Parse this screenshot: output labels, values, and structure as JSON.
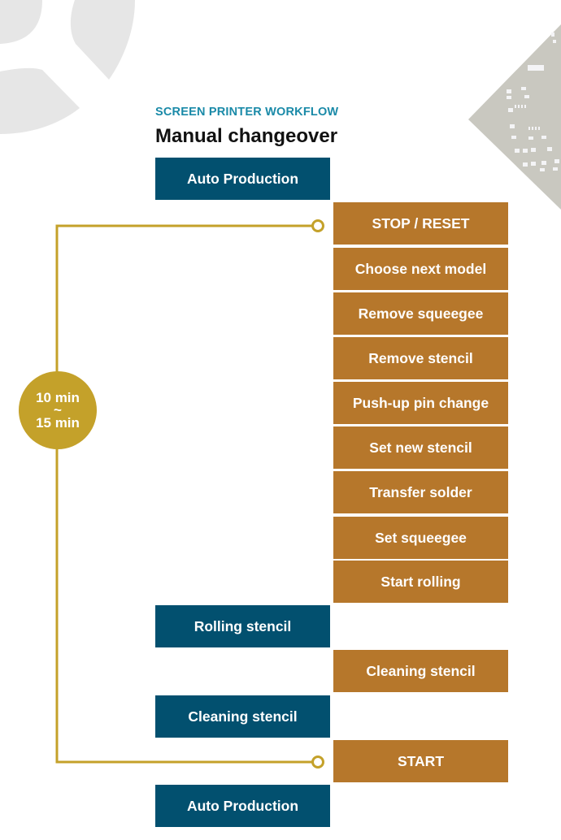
{
  "header": {
    "subtitle": "SCREEN PRINTER WORKFLOW",
    "title": "Manual changeover"
  },
  "colors": {
    "machine_step": "#02506f",
    "operator_step": "#b6772b",
    "timeline": "#c4a12a",
    "subtitle": "#1a8aa8"
  },
  "timer": {
    "from": "10 min",
    "separator": "~",
    "to": "15 min"
  },
  "steps": [
    {
      "label": "Auto Production",
      "lane": "machine"
    },
    {
      "label": "STOP / RESET",
      "lane": "operator"
    },
    {
      "label": "Choose next model",
      "lane": "operator"
    },
    {
      "label": "Remove squeegee",
      "lane": "operator"
    },
    {
      "label": "Remove stencil",
      "lane": "operator"
    },
    {
      "label": "Push-up pin change",
      "lane": "operator"
    },
    {
      "label": "Set new stencil",
      "lane": "operator"
    },
    {
      "label": "Transfer solder",
      "lane": "operator"
    },
    {
      "label": "Set squeegee",
      "lane": "operator"
    },
    {
      "label": "Start rolling",
      "lane": "operator"
    },
    {
      "label": "Rolling stencil",
      "lane": "machine"
    },
    {
      "label": "Cleaning stencil",
      "lane": "operator"
    },
    {
      "label": "Cleaning stencil",
      "lane": "machine"
    },
    {
      "label": "START",
      "lane": "operator"
    },
    {
      "label": "Auto Production",
      "lane": "machine"
    }
  ],
  "decorations": {
    "top_left": "logo-watermark-icon",
    "top_right": "stencil-photo"
  }
}
